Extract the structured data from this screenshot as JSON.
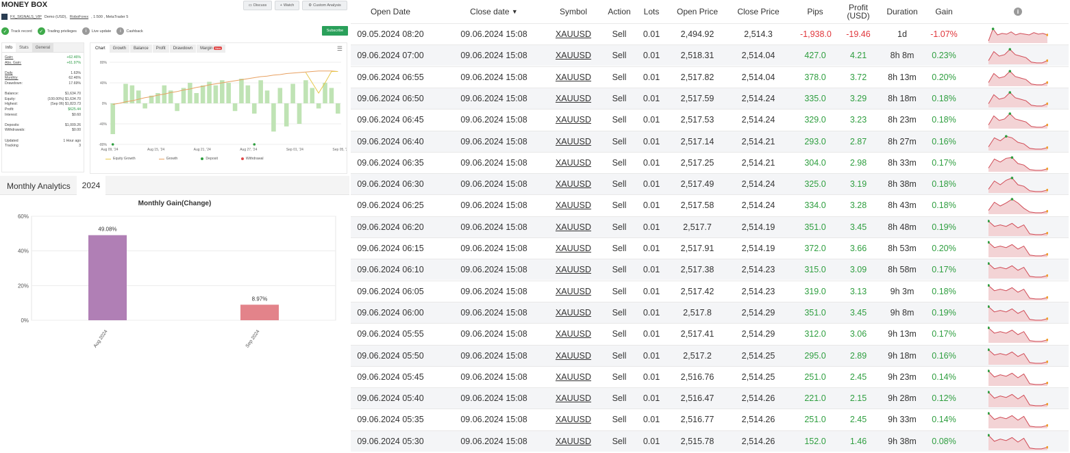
{
  "left": {
    "title": "MONEY BOX",
    "header_buttons": [
      {
        "label": "Discuss",
        "icon": "chat-icon"
      },
      {
        "label": "Watch",
        "icon": "plus-icon"
      },
      {
        "label": "Custom Analysis",
        "icon": "gear-icon"
      }
    ],
    "account": {
      "name": "FX_SIGNALS_VIP",
      "type": "Demo (USD),",
      "broker": "RoboForex",
      "rest": ", 1:500 , MetaTrader 5"
    },
    "badges": [
      {
        "label": "Track record",
        "icon": "check-icon",
        "color": "#3eaa4a"
      },
      {
        "label": "Trading privileges",
        "icon": "check-icon",
        "color": "#3eaa4a"
      },
      {
        "label": "Live update",
        "icon": "info-icon",
        "color": "#999999"
      },
      {
        "label": "Cashback",
        "icon": "info-icon",
        "color": "#999999"
      }
    ],
    "subscribe_label": "Subscribe",
    "info_tabs": [
      "Info",
      "Stats",
      "General"
    ],
    "info_rows": [
      {
        "k": "Gain:",
        "v": "+62.46%",
        "cls": "pos",
        "ul": true
      },
      {
        "k": "Abs. Gain:",
        "v": "+61.97%",
        "cls": "pos",
        "ul": true
      },
      {
        "k": "",
        "v": "",
        "cls": "",
        "ul": false
      },
      {
        "k": "Daily",
        "v": "1.63%",
        "cls": "",
        "ul": true
      },
      {
        "k": "Monthly:",
        "v": "62.46%",
        "cls": "",
        "ul": true
      },
      {
        "k": "Drawdown:",
        "v": "17.69%",
        "cls": "",
        "ul": false
      },
      {
        "k": "",
        "v": "",
        "cls": "",
        "ul": false
      },
      {
        "k": "Balance:",
        "v": "$1,634.70",
        "cls": "",
        "ul": false
      },
      {
        "k": "Equity:",
        "v": "(100.00%) $1,634.70",
        "cls": "",
        "ul": false
      },
      {
        "k": "Highest:",
        "v": "(Sep 06) $1,823.73",
        "cls": "",
        "ul": false
      },
      {
        "k": "Profit:",
        "v": "$625.44",
        "cls": "pos",
        "ul": false
      },
      {
        "k": "Interest:",
        "v": "$0.60",
        "cls": "",
        "ul": false
      },
      {
        "k": "",
        "v": "",
        "cls": "",
        "ul": false
      },
      {
        "k": "Deposits:",
        "v": "$1,009.26",
        "cls": "",
        "ul": false
      },
      {
        "k": "Withdrawals:",
        "v": "$0.00",
        "cls": "",
        "ul": false
      },
      {
        "k": "",
        "v": "",
        "cls": "",
        "ul": false
      },
      {
        "k": "Updated",
        "v": "1 Hour ago",
        "cls": "",
        "ul": false
      },
      {
        "k": "Tracking",
        "v": "3",
        "cls": "",
        "ul": false
      }
    ],
    "chart_tabs": [
      "Chart",
      "Growth",
      "Balance",
      "Profit",
      "Drawdown",
      "Margin"
    ],
    "new_badge": "New",
    "growth_legend": [
      "Equity Growth",
      "Growth",
      "Deposit",
      "Withdrawal"
    ],
    "monthly_header": "Monthly Analytics",
    "monthly_year": "2024",
    "monthly_chart_title": "Monthly Gain(Change)"
  },
  "chart_data": [
    {
      "type": "bar",
      "title": "",
      "x_ticks": [
        "Aug 09, '24",
        "Aug 15, '24",
        "Aug 21, '24",
        "Aug 27, '24",
        "Sep 01, '24",
        "Sep 05, '24"
      ],
      "y_ticks": [
        "80%",
        "40%",
        "0%",
        "-40%",
        "-80%"
      ],
      "ylim": [
        -80,
        80
      ],
      "bar_values": [
        -60,
        0,
        38,
        35,
        25,
        -10,
        15,
        20,
        35,
        25,
        -15,
        30,
        40,
        20,
        35,
        42,
        35,
        45,
        40,
        -15,
        48,
        35,
        -20,
        45,
        25,
        -55,
        30,
        -45,
        38,
        -40,
        45,
        30,
        -10,
        40,
        30,
        -20
      ],
      "series": [
        {
          "name": "Growth",
          "values": [
            -2,
            0,
            3,
            5,
            8,
            11,
            13,
            16,
            18,
            21,
            23,
            26,
            28,
            31,
            33,
            36,
            38,
            40,
            42,
            44,
            46,
            48,
            50,
            52,
            53,
            55,
            56,
            58,
            59,
            60,
            61,
            62,
            63,
            63,
            63,
            62
          ]
        },
        {
          "name": "Equity Growth",
          "values": [
            null,
            null,
            null,
            null,
            null,
            null,
            null,
            null,
            null,
            null,
            null,
            null,
            null,
            null,
            null,
            null,
            null,
            null,
            null,
            null,
            null,
            null,
            null,
            null,
            null,
            null,
            null,
            null,
            null,
            null,
            60,
            40,
            20,
            40,
            62,
            62
          ]
        }
      ],
      "markers": [
        {
          "name": "Deposit",
          "x_index": 0
        },
        {
          "name": "Deposit",
          "x_index": 22
        }
      ],
      "colors": {
        "bars": "#bfe3b4",
        "growth": "#e8a060",
        "equity": "#e6c84a",
        "deposit": "#2e9e3f",
        "withdrawal": "#e04848"
      }
    },
    {
      "type": "bar",
      "title": "Monthly Gain(Change)",
      "categories": [
        "Aug 2024",
        "Sep 2024"
      ],
      "values": [
        49.08,
        8.97
      ],
      "value_labels": [
        "49.08%",
        "8.97%"
      ],
      "y_ticks": [
        "60%",
        "40%",
        "20%",
        "0%"
      ],
      "ylim": [
        0,
        60
      ],
      "colors": [
        "#b07fb5",
        "#e3838a"
      ]
    }
  ],
  "table": {
    "headers": {
      "open_date": "Open Date",
      "close_date": "Close date",
      "sort_arrow": "▼",
      "symbol": "Symbol",
      "action": "Action",
      "lots": "Lots",
      "open_price": "Open Price",
      "close_price": "Close Price",
      "pips": "Pips",
      "profit": "Profit (USD)",
      "duration": "Duration",
      "gain": "Gain",
      "info_icon": "i"
    },
    "rows": [
      {
        "open": "09.05.2024 08:20",
        "close": "09.06.2024 15:08",
        "symbol": "XAUUSD",
        "action": "Sell",
        "lots": "0.01",
        "open_price": "2,494.92",
        "close_price": "2,514.3",
        "pips": "-1,938.0",
        "profit": "-19.46",
        "duration": "1d",
        "gain": "-1.07%",
        "neg": true
      },
      {
        "open": "09.06.2024 07:00",
        "close": "09.06.2024 15:08",
        "symbol": "XAUUSD",
        "action": "Sell",
        "lots": "0.01",
        "open_price": "2,518.31",
        "close_price": "2,514.04",
        "pips": "427.0",
        "profit": "4.21",
        "duration": "8h 8m",
        "gain": "0.23%",
        "neg": false
      },
      {
        "open": "09.06.2024 06:55",
        "close": "09.06.2024 15:08",
        "symbol": "XAUUSD",
        "action": "Sell",
        "lots": "0.01",
        "open_price": "2,517.82",
        "close_price": "2,514.04",
        "pips": "378.0",
        "profit": "3.72",
        "duration": "8h 13m",
        "gain": "0.20%",
        "neg": false
      },
      {
        "open": "09.06.2024 06:50",
        "close": "09.06.2024 15:08",
        "symbol": "XAUUSD",
        "action": "Sell",
        "lots": "0.01",
        "open_price": "2,517.59",
        "close_price": "2,514.24",
        "pips": "335.0",
        "profit": "3.29",
        "duration": "8h 18m",
        "gain": "0.18%",
        "neg": false
      },
      {
        "open": "09.06.2024 06:45",
        "close": "09.06.2024 15:08",
        "symbol": "XAUUSD",
        "action": "Sell",
        "lots": "0.01",
        "open_price": "2,517.53",
        "close_price": "2,514.24",
        "pips": "329.0",
        "profit": "3.23",
        "duration": "8h 23m",
        "gain": "0.18%",
        "neg": false
      },
      {
        "open": "09.06.2024 06:40",
        "close": "09.06.2024 15:08",
        "symbol": "XAUUSD",
        "action": "Sell",
        "lots": "0.01",
        "open_price": "2,517.14",
        "close_price": "2,514.21",
        "pips": "293.0",
        "profit": "2.87",
        "duration": "8h 27m",
        "gain": "0.16%",
        "neg": false
      },
      {
        "open": "09.06.2024 06:35",
        "close": "09.06.2024 15:08",
        "symbol": "XAUUSD",
        "action": "Sell",
        "lots": "0.01",
        "open_price": "2,517.25",
        "close_price": "2,514.21",
        "pips": "304.0",
        "profit": "2.98",
        "duration": "8h 33m",
        "gain": "0.17%",
        "neg": false
      },
      {
        "open": "09.06.2024 06:30",
        "close": "09.06.2024 15:08",
        "symbol": "XAUUSD",
        "action": "Sell",
        "lots": "0.01",
        "open_price": "2,517.49",
        "close_price": "2,514.24",
        "pips": "325.0",
        "profit": "3.19",
        "duration": "8h 38m",
        "gain": "0.18%",
        "neg": false
      },
      {
        "open": "09.06.2024 06:25",
        "close": "09.06.2024 15:08",
        "symbol": "XAUUSD",
        "action": "Sell",
        "lots": "0.01",
        "open_price": "2,517.58",
        "close_price": "2,514.24",
        "pips": "334.0",
        "profit": "3.28",
        "duration": "8h 43m",
        "gain": "0.18%",
        "neg": false
      },
      {
        "open": "09.06.2024 06:20",
        "close": "09.06.2024 15:08",
        "symbol": "XAUUSD",
        "action": "Sell",
        "lots": "0.01",
        "open_price": "2,517.7",
        "close_price": "2,514.19",
        "pips": "351.0",
        "profit": "3.45",
        "duration": "8h 48m",
        "gain": "0.19%",
        "neg": false
      },
      {
        "open": "09.06.2024 06:15",
        "close": "09.06.2024 15:08",
        "symbol": "XAUUSD",
        "action": "Sell",
        "lots": "0.01",
        "open_price": "2,517.91",
        "close_price": "2,514.19",
        "pips": "372.0",
        "profit": "3.66",
        "duration": "8h 53m",
        "gain": "0.20%",
        "neg": false
      },
      {
        "open": "09.06.2024 06:10",
        "close": "09.06.2024 15:08",
        "symbol": "XAUUSD",
        "action": "Sell",
        "lots": "0.01",
        "open_price": "2,517.38",
        "close_price": "2,514.23",
        "pips": "315.0",
        "profit": "3.09",
        "duration": "8h 58m",
        "gain": "0.17%",
        "neg": false
      },
      {
        "open": "09.06.2024 06:05",
        "close": "09.06.2024 15:08",
        "symbol": "XAUUSD",
        "action": "Sell",
        "lots": "0.01",
        "open_price": "2,517.42",
        "close_price": "2,514.23",
        "pips": "319.0",
        "profit": "3.13",
        "duration": "9h 3m",
        "gain": "0.18%",
        "neg": false
      },
      {
        "open": "09.06.2024 06:00",
        "close": "09.06.2024 15:08",
        "symbol": "XAUUSD",
        "action": "Sell",
        "lots": "0.01",
        "open_price": "2,517.8",
        "close_price": "2,514.29",
        "pips": "351.0",
        "profit": "3.45",
        "duration": "9h 8m",
        "gain": "0.19%",
        "neg": false
      },
      {
        "open": "09.06.2024 05:55",
        "close": "09.06.2024 15:08",
        "symbol": "XAUUSD",
        "action": "Sell",
        "lots": "0.01",
        "open_price": "2,517.41",
        "close_price": "2,514.29",
        "pips": "312.0",
        "profit": "3.06",
        "duration": "9h 13m",
        "gain": "0.17%",
        "neg": false
      },
      {
        "open": "09.06.2024 05:50",
        "close": "09.06.2024 15:08",
        "symbol": "XAUUSD",
        "action": "Sell",
        "lots": "0.01",
        "open_price": "2,517.2",
        "close_price": "2,514.25",
        "pips": "295.0",
        "profit": "2.89",
        "duration": "9h 18m",
        "gain": "0.16%",
        "neg": false
      },
      {
        "open": "09.06.2024 05:45",
        "close": "09.06.2024 15:08",
        "symbol": "XAUUSD",
        "action": "Sell",
        "lots": "0.01",
        "open_price": "2,516.76",
        "close_price": "2,514.25",
        "pips": "251.0",
        "profit": "2.45",
        "duration": "9h 23m",
        "gain": "0.14%",
        "neg": false
      },
      {
        "open": "09.06.2024 05:40",
        "close": "09.06.2024 15:08",
        "symbol": "XAUUSD",
        "action": "Sell",
        "lots": "0.01",
        "open_price": "2,516.47",
        "close_price": "2,514.26",
        "pips": "221.0",
        "profit": "2.15",
        "duration": "9h 28m",
        "gain": "0.12%",
        "neg": false
      },
      {
        "open": "09.06.2024 05:35",
        "close": "09.06.2024 15:08",
        "symbol": "XAUUSD",
        "action": "Sell",
        "lots": "0.01",
        "open_price": "2,516.77",
        "close_price": "2,514.26",
        "pips": "251.0",
        "profit": "2.45",
        "duration": "9h 33m",
        "gain": "0.14%",
        "neg": false
      },
      {
        "open": "09.06.2024 05:30",
        "close": "09.06.2024 15:08",
        "symbol": "XAUUSD",
        "action": "Sell",
        "lots": "0.01",
        "open_price": "2,515.78",
        "close_price": "2,514.26",
        "pips": "152.0",
        "profit": "1.46",
        "duration": "9h 38m",
        "gain": "0.08%",
        "neg": false
      }
    ],
    "colors": {
      "negative": "#e0363b",
      "positive": "#2e9e3f",
      "spark_fill": "#f3d3d5",
      "spark_line": "#d04a55"
    }
  }
}
